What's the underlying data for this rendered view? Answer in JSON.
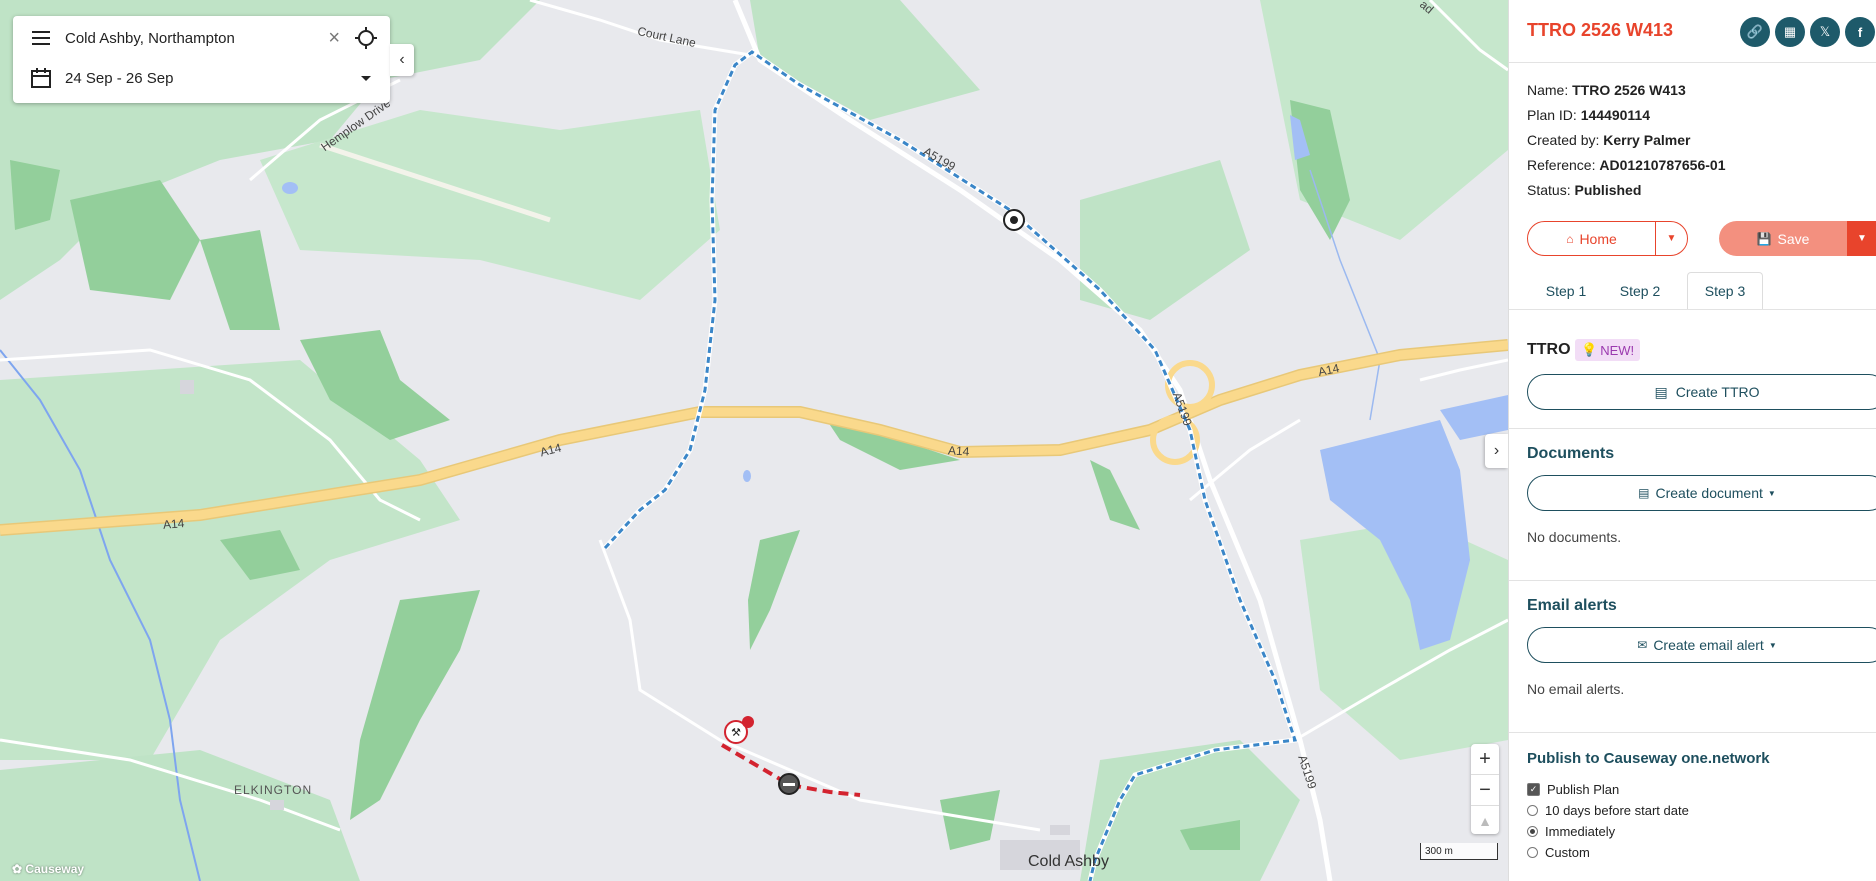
{
  "map": {
    "labels": {
      "court_lane": "Court Lane",
      "hemplow_drive": "Hemplow Drive",
      "a5199_top": "A5199",
      "a5199_mid": "A5199",
      "a5199_bottom": "A5199",
      "a14_left": "A14",
      "a14_mid": "A14",
      "a14_centre": "A14",
      "a14_right": "A14",
      "elkington": "ELKINGTON",
      "cold_ashby": "Cold Ashby",
      "road_top": "ad"
    },
    "scale_label": "300 m",
    "zoom_in": "+",
    "zoom_out": "−",
    "compass": "▲",
    "logo_text": "Causeway",
    "colors": {
      "water": "#a3bff5",
      "wood": "#93cf9b",
      "wood_light": "#bfe3c6",
      "major_road": "#fad98c",
      "route_blue": "#3a86c8",
      "route_red": "#d3232f"
    }
  },
  "search": {
    "location": "Cold Ashby, Northampton",
    "dates": "24 Sep - 26 Sep",
    "menu_icon": "menu-icon",
    "calendar_icon": "calendar-icon",
    "clear_icon": "close-icon",
    "locate_icon": "crosshair-icon",
    "dropdown_icon": "caret-down-icon"
  },
  "panel": {
    "title": "TTRO 2526 W413",
    "share_icons": [
      "link-icon",
      "qr-icon",
      "x-icon",
      "facebook-icon"
    ],
    "share_glyphs": [
      "🔗",
      "▦",
      "𝕏",
      "f"
    ],
    "info": {
      "name_label": "Name:",
      "name_value": "TTRO 2526 W413",
      "plan_id_label": "Plan ID:",
      "plan_id_value": "144490114",
      "created_by_label": "Created by:",
      "created_by_value": "Kerry Palmer",
      "reference_label": "Reference:",
      "reference_value": "AD01210787656-01",
      "status_label": "Status:",
      "status_value": "Published"
    },
    "home_button": "Home",
    "save_button": "Save",
    "tabs": [
      "Step 1",
      "Step 2",
      "Step 3"
    ],
    "active_tab": "Step 3",
    "ttro": {
      "title": "TTRO",
      "badge": "NEW!",
      "create_button": "Create TTRO"
    },
    "documents": {
      "title": "Documents",
      "create_button": "Create document",
      "empty": "No documents."
    },
    "email_alerts": {
      "title": "Email alerts",
      "create_button": "Create email alert",
      "empty": "No email alerts."
    },
    "publish": {
      "title": "Publish to Causeway one.network",
      "publish_plan": "Publish Plan",
      "publish_plan_checked": true,
      "options": [
        "10 days before start date",
        "Immediately",
        "Custom"
      ],
      "selected_option": "Immediately"
    }
  }
}
